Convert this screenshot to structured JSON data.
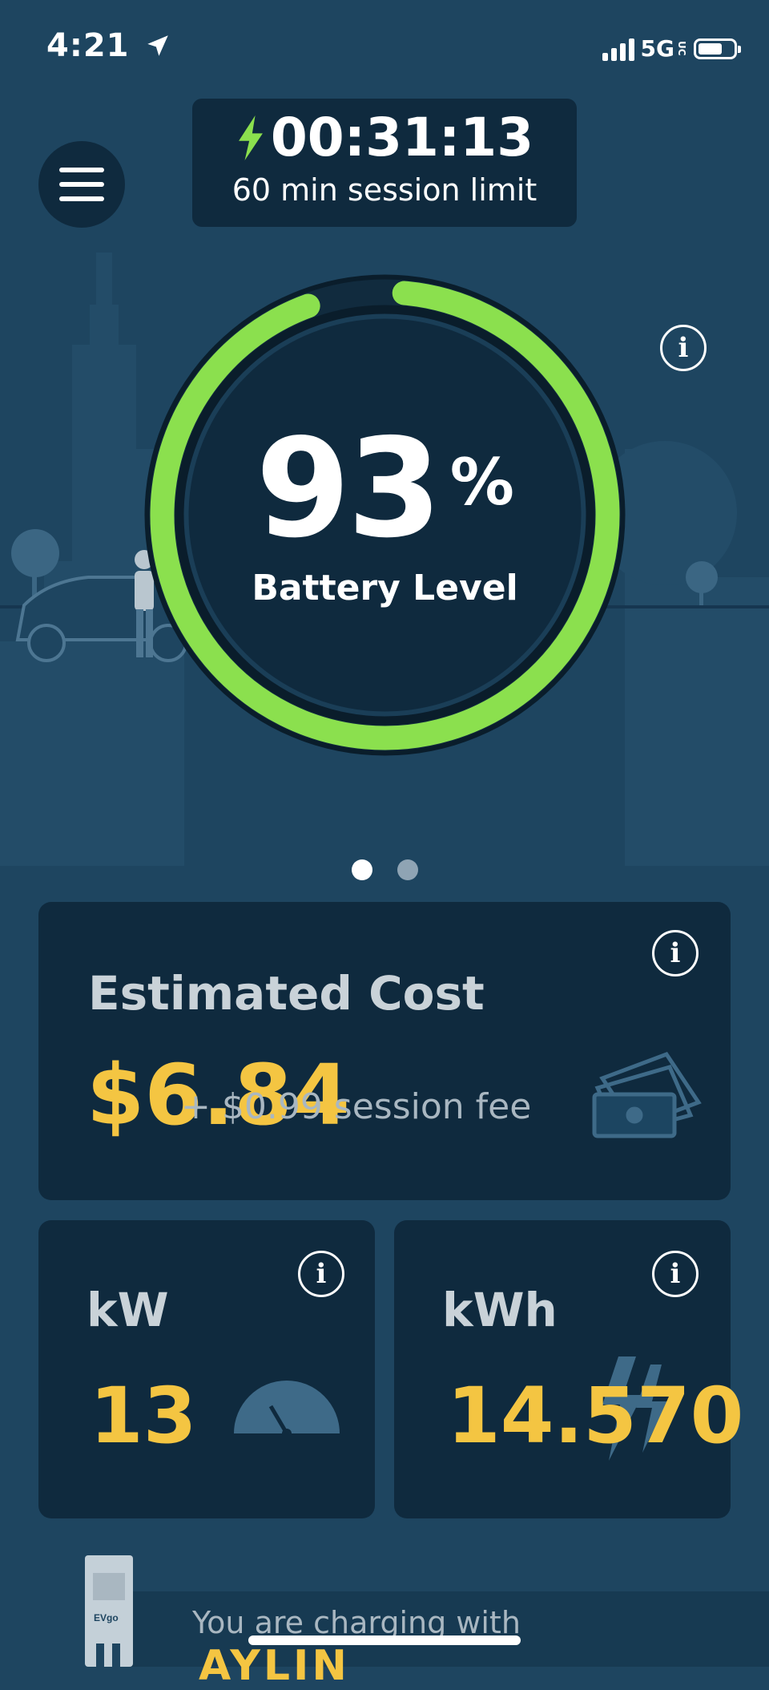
{
  "status_bar": {
    "time": "4:21",
    "network": "5G",
    "network_suffix": "UC"
  },
  "session": {
    "timer": "00:31:13",
    "limit_text": "60 min session limit"
  },
  "battery": {
    "percent": "93",
    "percent_sign": "%",
    "label": "Battery Level",
    "level_fraction": 0.93
  },
  "carousel": {
    "pages": 2,
    "active": 1
  },
  "cost_card": {
    "title": "Estimated Cost",
    "amount": "$6.84",
    "fee_text": "+ $0.99 session fee"
  },
  "kw_card": {
    "title": "kW",
    "value": "13"
  },
  "kwh_card": {
    "title": "kWh",
    "value": "14.570"
  },
  "footer": {
    "charging_with": "You are charging with",
    "network_name": "AYLIN"
  },
  "colors": {
    "background": "#1e4560",
    "card": "#0f2a3e",
    "ring": "#8be04e",
    "accent": "#f4c542"
  },
  "icons": [
    "location-arrow-icon",
    "signal-icon",
    "battery-icon",
    "menu-icon",
    "bolt-icon",
    "info-icon",
    "money-icon",
    "gauge-icon",
    "lightning-icon"
  ]
}
